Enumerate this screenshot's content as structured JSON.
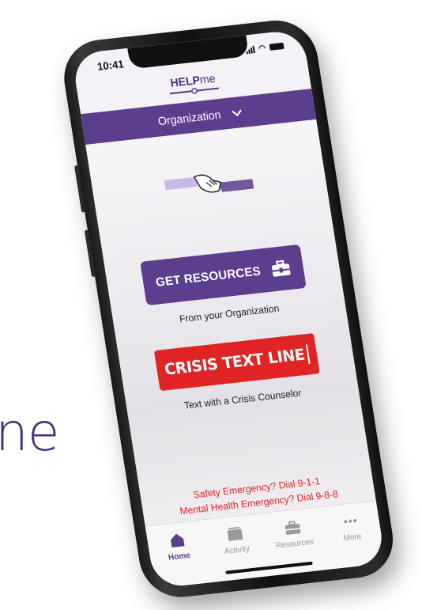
{
  "background_text": "ne",
  "status": {
    "time": "10:41"
  },
  "header": {
    "logo_bold": "HELP",
    "logo_rest": "me"
  },
  "org_selector": {
    "label": "Organization"
  },
  "get_resources": {
    "label": "GET RESOURCES",
    "caption": "From your Organization"
  },
  "crisis": {
    "label": "CRISIS TEXT LINE",
    "caption": "Text with a Crisis Counselor"
  },
  "emergency": {
    "safety": "Safety Emergency? Dial 9-1-1",
    "mental": "Mental Health Emergency? Dial 9-8-8"
  },
  "tabs": [
    {
      "label": "Home",
      "icon": "home-icon",
      "active": true
    },
    {
      "label": "Activity",
      "icon": "folder-icon",
      "active": false
    },
    {
      "label": "Resources",
      "icon": "toolbox-icon",
      "active": false
    },
    {
      "label": "More",
      "icon": "more-dots-icon",
      "active": false
    }
  ],
  "colors": {
    "brand_purple": "#5b3e8e",
    "crisis_red": "#e02424",
    "text_purple": "#4b2e7f"
  }
}
